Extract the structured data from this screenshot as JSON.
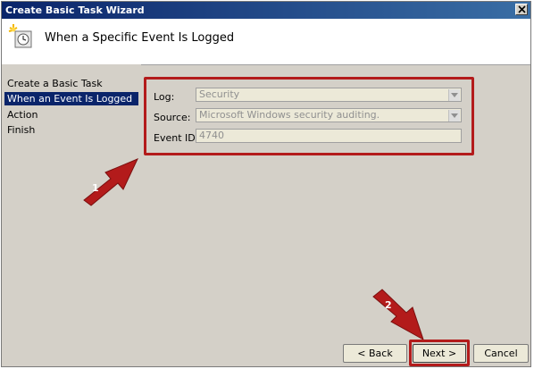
{
  "window": {
    "title": "Create Basic Task Wizard",
    "close_glyph": "✕"
  },
  "header": {
    "title": "When a Specific Event Is Logged",
    "icon": "task-clock-icon"
  },
  "sidebar": {
    "items": [
      {
        "label": "Create a Basic Task",
        "selected": false
      },
      {
        "label": "When an Event Is Logged",
        "selected": true
      },
      {
        "label": "Action",
        "selected": false
      },
      {
        "label": "Finish",
        "selected": false
      }
    ]
  },
  "form": {
    "log_label": "Log:",
    "log_value": "Security",
    "source_label": "Source:",
    "source_value": "Microsoft Windows security auditing.",
    "event_id_label": "Event ID:",
    "event_id_value": "4740"
  },
  "annotations": {
    "arrow1_number": "1",
    "arrow2_number": "2",
    "highlight_color": "#b31b1b"
  },
  "buttons": {
    "back": "< Back",
    "next": "Next >",
    "cancel": "Cancel"
  },
  "colors": {
    "title_bar": "#0a246a",
    "selection": "#0a246a",
    "annotation_red": "#b31b1b"
  }
}
